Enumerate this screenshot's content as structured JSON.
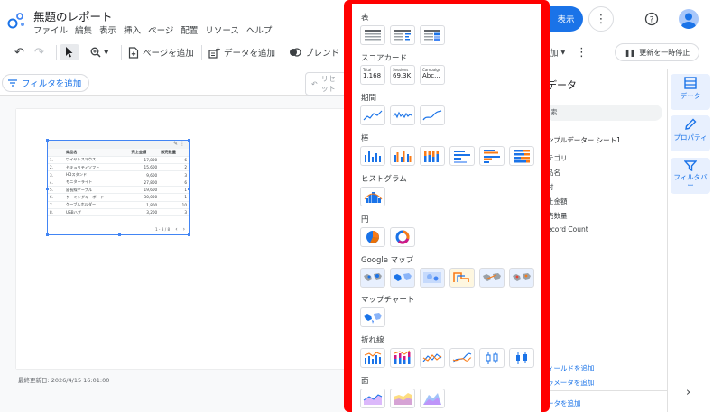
{
  "app": {
    "title": "無題のレポート",
    "menu": [
      "ファイル",
      "編集",
      "表示",
      "挿入",
      "ページ",
      "配置",
      "リソース",
      "ヘルプ"
    ],
    "share_label": "表示",
    "pause_label": "更新を一時停止"
  },
  "toolbar": {
    "add_page_label": "ページを追加",
    "add_data_label": "データを追加",
    "blend_label": "ブレンド",
    "add_suffix": "加"
  },
  "filterbar": {
    "add_filter_label": "フィルタを追加",
    "reset_label_1": "リセ",
    "reset_label_2": "ット"
  },
  "canvas": {
    "last_updated": "最終更新日: 2026/4/15 16:01:00"
  },
  "table_widget": {
    "headers": [
      "商品名",
      "売上金額",
      "販売数量"
    ],
    "rows": [
      {
        "idx": "1.",
        "name": "ワイヤレスマウス",
        "sales": "17,800",
        "qty": "6"
      },
      {
        "idx": "2.",
        "name": "セキュリティソフト",
        "sales": "15,600",
        "qty": "2"
      },
      {
        "idx": "3.",
        "name": "HDスタンド",
        "sales": "9,600",
        "qty": "3"
      },
      {
        "idx": "4.",
        "name": "モニターライト",
        "sales": "27,800",
        "qty": "6"
      },
      {
        "idx": "5.",
        "name": "延長線ケーブル",
        "sales": "19,600",
        "qty": "1"
      },
      {
        "idx": "6.",
        "name": "ゲーミングキーボード",
        "sales": "30,000",
        "qty": "1"
      },
      {
        "idx": "7.",
        "name": "ケーブルホルダー",
        "sales": "1,800",
        "qty": "10"
      },
      {
        "idx": "8.",
        "name": "USBハブ",
        "sales": "3,200",
        "qty": "3"
      }
    ],
    "pagination": "1 - 8 / 8"
  },
  "chart_picker": {
    "sections": {
      "table": "表",
      "scorecard": "スコアカード",
      "timeseries": "期間",
      "bar": "棒",
      "histogram": "ヒストグラム",
      "pie": "円",
      "geo": "Google マップ",
      "mapchart": "マップチャート",
      "line": "折れ線",
      "area": "面"
    },
    "scorecards": [
      {
        "label": "Total",
        "value": "1,168"
      },
      {
        "label": "Sessions",
        "value": "69.3K"
      },
      {
        "label": "Campaign",
        "value": "Abc..."
      }
    ]
  },
  "right_panel": {
    "title": "データ",
    "search_placeholder": "索",
    "source": "ンプルデーター シート1",
    "fields": [
      "テゴリ",
      "品名",
      "付",
      "上金額",
      "売数量",
      "ecord Count"
    ],
    "add_field": "ィールドを追加",
    "add_param": "ラメータを追加",
    "add_data": "ータを追加"
  },
  "rail": {
    "data_label": "データ",
    "props_label": "プロパティ",
    "filter_label": "フィルタバー"
  },
  "colors": {
    "accent": "#1a73e8",
    "picker_border": "#ff0000"
  }
}
